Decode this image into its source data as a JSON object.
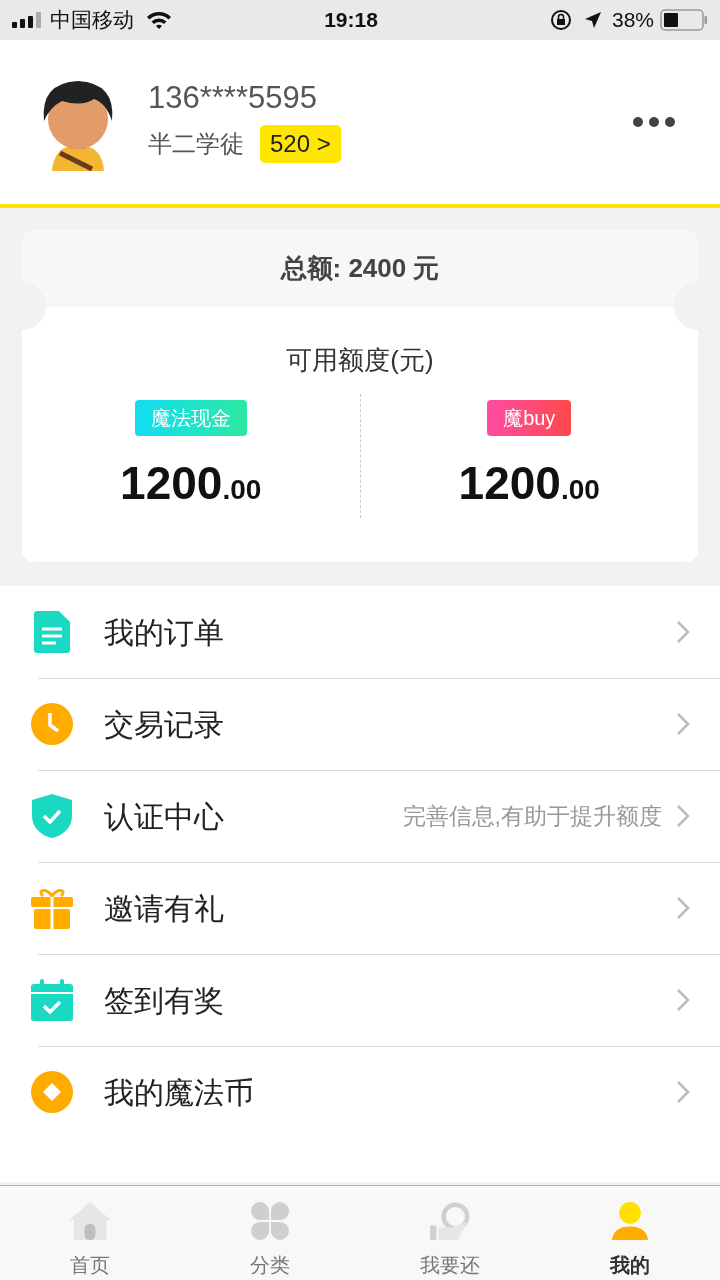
{
  "status_bar": {
    "carrier": "中国移动",
    "time": "19:18",
    "battery": "38%"
  },
  "profile": {
    "phone": "136****5595",
    "rank": "半二学徒",
    "points": "520 >"
  },
  "credit": {
    "total": "总额: 2400 元",
    "available_label": "可用额度(元)",
    "accounts": [
      {
        "tag": "魔法现金",
        "amount": "1200",
        "cents": ".00"
      },
      {
        "tag": "魔buy",
        "amount": "1200",
        "cents": ".00"
      }
    ]
  },
  "menu": [
    {
      "label": "我的订单"
    },
    {
      "label": "交易记录"
    },
    {
      "label": "认证中心",
      "hint": "完善信息,有助于提升额度"
    },
    {
      "label": "邀请有礼"
    },
    {
      "label": "签到有奖"
    },
    {
      "label": "我的魔法币"
    }
  ],
  "tab_bar": [
    {
      "label": "首页",
      "selected": false
    },
    {
      "label": "分类",
      "selected": false
    },
    {
      "label": "我要还",
      "selected": false
    },
    {
      "label": "我的",
      "selected": true
    }
  ]
}
